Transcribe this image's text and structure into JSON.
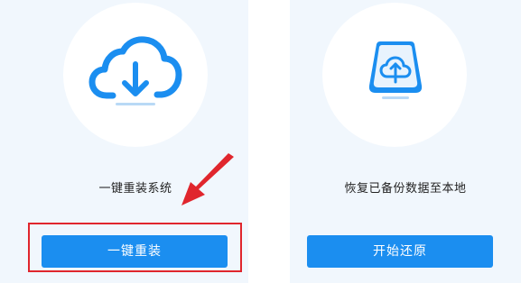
{
  "panels": [
    {
      "icon": "cloud-download-icon",
      "caption": "一键重装系统",
      "button_label": "一键重装"
    },
    {
      "icon": "cloud-upload-drive-icon",
      "caption": "恢复已备份数据至本地",
      "button_label": "开始还原"
    }
  ],
  "colors": {
    "panel_bg": "#f1f7fd",
    "accent_blue": "#1b8ef0",
    "annotation_red": "#e0262d"
  }
}
